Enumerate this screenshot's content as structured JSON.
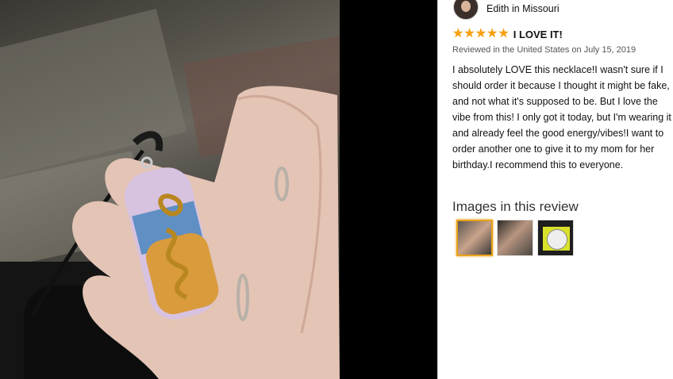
{
  "review": {
    "reviewer_name": "Edith in Missouri",
    "rating": 5,
    "stars": [
      "★",
      "★",
      "★",
      "★",
      "★"
    ],
    "title": "I LOVE IT!",
    "date": "Reviewed in the United States on July 15, 2019",
    "body": "I absolutely LOVE this necklace!I wasn't sure if I should order it because I thought it might be fake, and not what it's supposed to be. But I love the vibe from this! I only got it today, but I'm wearing it and already feel the good energy/vibes!I want to order another one to give it to my mom for her birthday.I recommend this to everyone.",
    "images_heading": "Images in this review",
    "thumbnails": [
      "necklace-in-hand-thumbnail",
      "necklace-hanging-thumbnail",
      "packaging-card-thumbnail"
    ]
  },
  "colors": {
    "star": "#f7a10c",
    "selected_border": "#e7a21b"
  }
}
